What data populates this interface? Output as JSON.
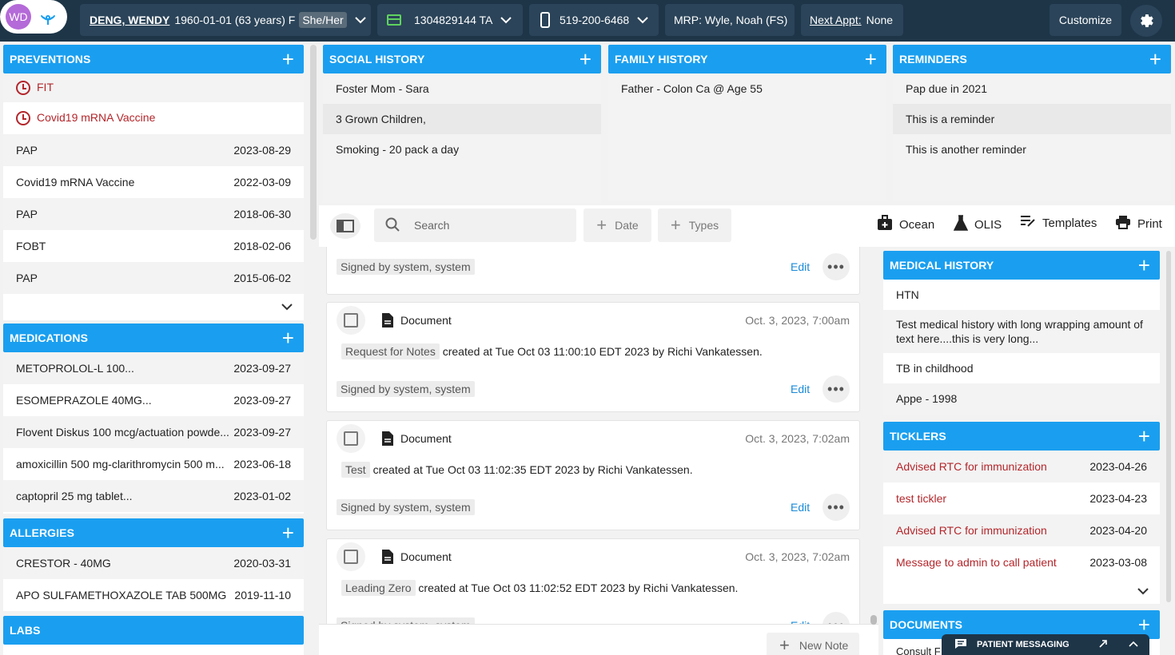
{
  "topbar": {
    "avatar_initials": "WD",
    "patient_name": "DENG, WENDY",
    "patient_info": "1960-01-01 (63 years) F",
    "pronoun": "She/Her",
    "health_card": "1304829144 TA",
    "phone": "519-200-6468",
    "mrp": "MRP:  Wyle, Noah  (FS)",
    "next_appt_label": "Next Appt:",
    "next_appt_value": "None",
    "customize_label": "Customize"
  },
  "preventions": {
    "title": "PREVENTIONS",
    "due": [
      {
        "label": "FIT"
      },
      {
        "label": "Covid19 mRNA Vaccine"
      }
    ],
    "items": [
      {
        "label": "PAP",
        "date": "2023-08-29"
      },
      {
        "label": "Covid19 mRNA Vaccine",
        "date": "2022-03-09"
      },
      {
        "label": "PAP",
        "date": "2018-06-30"
      },
      {
        "label": "FOBT",
        "date": "2018-02-06"
      },
      {
        "label": "PAP",
        "date": "2015-06-02"
      }
    ]
  },
  "medications": {
    "title": "MEDICATIONS",
    "items": [
      {
        "label": "METOPROLOL-L 100...",
        "date": "2023-09-27"
      },
      {
        "label": "ESOMEPRAZOLE 40MG...",
        "date": "2023-09-27"
      },
      {
        "label": "Flovent Diskus 100 mcg/actuation powde...",
        "date": "2023-09-27"
      },
      {
        "label": "amoxicillin 500 mg-clarithromycin 500 m...",
        "date": "2023-06-18"
      },
      {
        "label": "captopril 25 mg tablet...",
        "date": "2023-01-02"
      }
    ]
  },
  "allergies": {
    "title": "ALLERGIES",
    "items": [
      {
        "label": "CRESTOR - 40MG",
        "date": "2020-03-31"
      },
      {
        "label": "APO SULFAMETHOXAZOLE TAB 500MG",
        "date": "2019-11-10"
      }
    ]
  },
  "labs": {
    "title": "LABS"
  },
  "social_history": {
    "title": "SOCIAL HISTORY",
    "items": [
      "Foster Mom - Sara",
      "3 Grown Children,",
      "Smoking - 20 pack a day"
    ]
  },
  "family_history": {
    "title": "FAMILY HISTORY",
    "items": [
      "Father - Colon Ca @ Age 55"
    ]
  },
  "reminders": {
    "title": "REMINDERS",
    "items": [
      "Pap due in 2021",
      "This is a reminder",
      "This is another reminder"
    ]
  },
  "toolbar": {
    "search_placeholder": "Search",
    "date_label": "Date",
    "types_label": "Types",
    "ocean_label": "Ocean",
    "olis_label": "OLIS",
    "templates_label": "Templates",
    "print_label": "Print"
  },
  "notes": {
    "first_signed": "Signed by system, system",
    "edit_label": "Edit",
    "cards": [
      {
        "type": "Document",
        "time": "Oct. 3, 2023, 7:00am",
        "tag": "Request for Notes",
        "text": "created at Tue Oct 03 11:00:10 EDT 2023 by Richi Vankatessen.",
        "signed": "Signed by system, system"
      },
      {
        "type": "Document",
        "time": "Oct. 3, 2023, 7:02am",
        "tag": "Test",
        "text": "created at Tue Oct 03 11:02:35 EDT 2023 by Richi Vankatessen.",
        "signed": "Signed by system, system"
      },
      {
        "type": "Document",
        "time": "Oct. 3, 2023, 7:02am",
        "tag": "Leading Zero",
        "text": "created at Tue Oct 03 11:02:52 EDT 2023 by Richi Vankatessen.",
        "signed": "Signed by system, system"
      }
    ],
    "new_note_label": "New Note"
  },
  "medical_history": {
    "title": "MEDICAL HISTORY",
    "items": [
      "HTN",
      "Test medical history with long wrapping amount of text here....this is very long...",
      "TB in childhood",
      "Appe - 1998"
    ]
  },
  "ticklers": {
    "title": "TICKLERS",
    "items": [
      {
        "label": "Advised RTC for immunization",
        "date": "2023-04-26"
      },
      {
        "label": "test tickler",
        "date": "2023-04-23"
      },
      {
        "label": "Advised RTC for immunization",
        "date": "2023-04-20"
      },
      {
        "label": "Message to admin to call patient",
        "date": "2023-03-08"
      }
    ]
  },
  "documents": {
    "title": "DOCUMENTS",
    "first_item": "Consult F"
  },
  "messaging": {
    "label": "PATIENT MESSAGING"
  },
  "colors": {
    "header_blue": "#1a9ff0",
    "topbar": "#1e3548",
    "due_red": "#b3262b",
    "link_blue": "#1a8ad8"
  }
}
